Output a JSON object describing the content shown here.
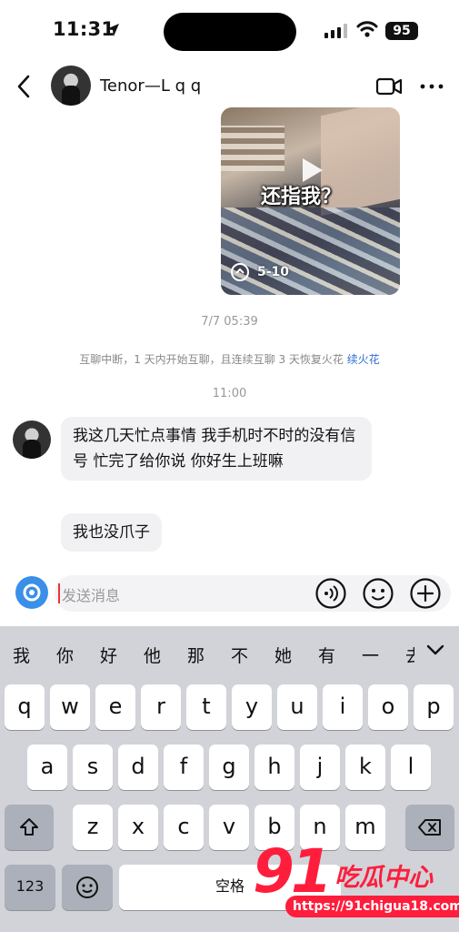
{
  "status_bar": {
    "time": "11:31",
    "battery": "95"
  },
  "header": {
    "title": "Tenor—L q q"
  },
  "video_card": {
    "caption": "还指我？",
    "count": "5-10"
  },
  "chat": {
    "timestamp_1": "7/7 05:39",
    "notice": "互聊中断，1 天内开始互聊，且连续互聊 3 天恢复火花",
    "notice_link": "续火花",
    "timestamp_2": "11:00",
    "messages": [
      {
        "text": "我这几天忙点事情 我手机时不时的没有信号 忙完了给你说 你好生上班嘛"
      },
      {
        "text": "我也没爪子"
      }
    ]
  },
  "input": {
    "placeholder": "发送消息"
  },
  "keyboard": {
    "candidates": [
      "我",
      "你",
      "好",
      "他",
      "那",
      "不",
      "她",
      "有",
      "一",
      "去"
    ],
    "row1": [
      "q",
      "w",
      "e",
      "r",
      "t",
      "y",
      "u",
      "i",
      "o",
      "p"
    ],
    "row2": [
      "a",
      "s",
      "d",
      "f",
      "g",
      "h",
      "j",
      "k",
      "l"
    ],
    "row3": [
      "z",
      "x",
      "c",
      "v",
      "b",
      "n",
      "m"
    ],
    "num_label": "123",
    "space_label": "空格"
  },
  "watermark": {
    "number": "91",
    "text": "吃瓜中心",
    "url": "https://91chigua18.com"
  }
}
